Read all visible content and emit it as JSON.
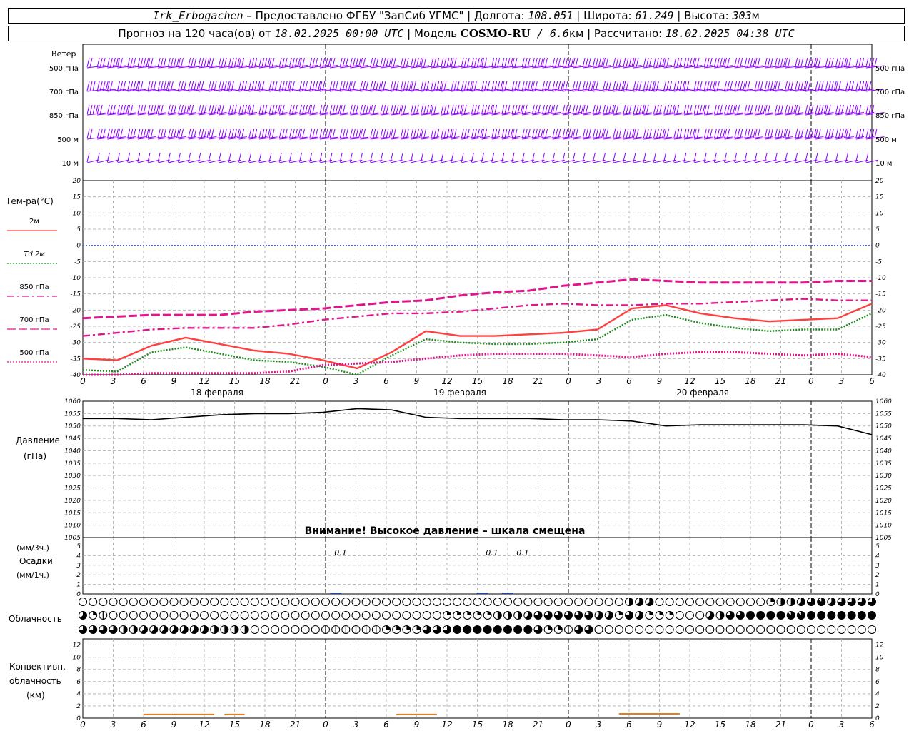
{
  "header": {
    "station": "Irk_Erbogachen",
    "provider": " – Предоставлено ФГБУ \"ЗапСиб УГМС\" | Долгота: ",
    "longitude": "108.051",
    "lat_label": " | Широта: ",
    "latitude": "61.249",
    "alt_label": " | Высота: ",
    "altitude": "303",
    "alt_unit": "м",
    "forecast_prefix": "Прогноз на 120 часа(ов) от ",
    "forecast_start": "18.02.2025 00:00 UTC",
    "model_label": " | Модель ",
    "model": "COSMO-RU",
    "resolution": " / 6.6",
    "res_unit": "км | Рассчитано: ",
    "computed": "18.02.2025 04:38 UTC"
  },
  "wind_panel": {
    "title": "Ветер",
    "levels": [
      "500 гПа",
      "700 гПа",
      "850 гПа",
      "500 м",
      "10 м"
    ],
    "color": "#8b00ff"
  },
  "temp_panel": {
    "title": "Тем-ра(°C)",
    "legend": [
      {
        "label": "2м",
        "color": "#ff4040",
        "style": "solid"
      },
      {
        "label": "Td 2м",
        "color": "#1a8a1a",
        "style": "dotted"
      },
      {
        "label": "850 гПа",
        "color": "#e0168c",
        "style": "dashdot"
      },
      {
        "label": "700 гПа",
        "color": "#e0168c",
        "style": "dash"
      },
      {
        "label": "500 гПа",
        "color": "#e0168c",
        "style": "dot"
      }
    ],
    "date_labels": [
      "18 февраля",
      "19 февраля",
      "20 февраля"
    ]
  },
  "pressure_panel": {
    "title": "Давление",
    "unit": "(гПа)",
    "warning": "Внимание! Высокое давление – шкала смещена"
  },
  "precip_panel": {
    "unit3": "(мм/3ч.)",
    "title": "Осадки",
    "unit1": "(мм/1ч.)",
    "annotations": [
      "0.1",
      "0.1",
      "0.1"
    ]
  },
  "cloud_panel": {
    "title": "Облачность"
  },
  "conv_panel": {
    "title": [
      "Конвективн.",
      "облачность",
      "(км)"
    ],
    "color": "#e08020"
  },
  "chart_data": [
    {
      "type": "line",
      "title": "Тем-ра(°C)",
      "ylim": [
        -40,
        20
      ],
      "y_ticks": [
        20,
        15,
        10,
        5,
        0,
        -5,
        -10,
        -15,
        -20,
        -25,
        -30,
        -35,
        -40
      ],
      "x": [
        0,
        3,
        6,
        9,
        12,
        15,
        18,
        21,
        24,
        27,
        30,
        33,
        36,
        39,
        42,
        45,
        48,
        51,
        54,
        57,
        60,
        63,
        66,
        69,
        72,
        75,
        78
      ],
      "x_tick_labels": [
        "0",
        "3",
        "6",
        "9",
        "12",
        "15",
        "18",
        "21",
        "0",
        "3",
        "6",
        "9",
        "12",
        "15",
        "18",
        "21",
        "0",
        "3",
        "6",
        "9",
        "12",
        "15",
        "18",
        "21",
        "0",
        "3",
        "6"
      ],
      "series": [
        {
          "name": "2м",
          "values": [
            -35,
            -35.5,
            -31,
            -28.5,
            -30.5,
            -32.5,
            -33.5,
            -35.5,
            -38,
            -33,
            -26.5,
            -28,
            -28,
            -27.5,
            -27,
            -26,
            -19.5,
            -18.5,
            -21,
            -22.5,
            -23.5,
            -23,
            -22.5,
            -18
          ]
        },
        {
          "name": "Td 2м",
          "values": [
            -38.5,
            -39,
            -33,
            -31.5,
            -33.5,
            -35.5,
            -36,
            -37.5,
            -40,
            -34,
            -29,
            -30,
            -30.5,
            -30.5,
            -30,
            -29,
            -23,
            -21.5,
            -24,
            -25.5,
            -26.5,
            -26,
            -26,
            -21
          ]
        },
        {
          "name": "850 гПа",
          "values": [
            -28,
            -27,
            -26,
            -25.5,
            -25.5,
            -25.5,
            -24.5,
            -23,
            -22,
            -21,
            -21,
            -20.5,
            -19.5,
            -18.5,
            -18,
            -18.5,
            -18.5,
            -18,
            -18,
            -17.5,
            -17,
            -16.5,
            -17,
            -17
          ]
        },
        {
          "name": "700 гПа",
          "values": [
            -22.5,
            -22,
            -21.5,
            -21.5,
            -21.5,
            -20.5,
            -20,
            -19.5,
            -18.5,
            -17.5,
            -17,
            -15.5,
            -14.5,
            -14,
            -12.5,
            -11.5,
            -10.5,
            -11,
            -11.5,
            -11.5,
            -11.5,
            -11.5,
            -11,
            -11
          ]
        },
        {
          "name": "500 гПа",
          "values": [
            -40,
            -40,
            -39.5,
            -39.5,
            -39.5,
            -39.5,
            -39,
            -37,
            -36.5,
            -36,
            -35,
            -34,
            -33.5,
            -33.5,
            -33.5,
            -34,
            -34.5,
            -33.5,
            -33,
            -33,
            -33.5,
            -34,
            -33.5,
            -34.5
          ]
        }
      ]
    },
    {
      "type": "line",
      "title": "Давление",
      "ylim": [
        1005,
        1060
      ],
      "y_ticks": [
        1060,
        1055,
        1050,
        1045,
        1040,
        1035,
        1030,
        1025,
        1020,
        1015,
        1010,
        1005
      ],
      "series": [
        {
          "name": "Давление",
          "values": [
            1053,
            1053,
            1052.5,
            1053.5,
            1054.5,
            1055,
            1055,
            1055.5,
            1057,
            1056.5,
            1053.5,
            1053,
            1053,
            1053,
            1052.5,
            1052.5,
            1052,
            1050,
            1050.5,
            1050.5,
            1050.5,
            1050.5,
            1050,
            1046.5
          ]
        }
      ]
    },
    {
      "type": "bar",
      "title": "Осадки",
      "ylim": [
        0,
        5
      ],
      "y_ticks": [
        5,
        4,
        3,
        2,
        1,
        0
      ],
      "bars": [
        {
          "x": 25,
          "value": 0.1
        },
        {
          "x": 39.5,
          "value": 0.1
        },
        {
          "x": 42,
          "value": 0.1
        }
      ]
    },
    {
      "type": "area",
      "title": "Конвективн. облачность (км)",
      "ylim": [
        0,
        13
      ],
      "y_ticks": [
        12,
        10,
        8,
        6,
        4,
        2,
        0
      ],
      "segments": [
        {
          "x": [
            6,
            13
          ],
          "value": 0.6
        },
        {
          "x": [
            14,
            16
          ],
          "value": 0.6
        },
        {
          "x": [
            31,
            35
          ],
          "value": 0.6
        },
        {
          "x": [
            53,
            59
          ],
          "value": 0.7
        }
      ]
    },
    {
      "type": "table",
      "title": "Облачность",
      "rows": [
        {
          "level": "upper",
          "runs": [
            [
              0,
              53,
              0
            ],
            [
              54,
              55,
              4
            ],
            [
              55,
              56,
              5
            ],
            [
              56,
              57,
              5
            ],
            [
              57,
              68,
              0
            ],
            [
              68,
              69,
              3
            ],
            [
              69,
              70,
              4
            ],
            [
              70,
              71,
              4
            ],
            [
              71,
              72,
              5
            ],
            [
              72,
              73,
              6
            ],
            [
              73,
              74,
              7
            ],
            [
              74,
              75,
              5
            ],
            [
              75,
              78,
              6
            ]
          ]
        },
        {
          "level": "middle",
          "runs": [
            [
              0,
              1,
              5
            ],
            [
              1,
              2,
              3
            ],
            [
              2,
              3,
              2
            ],
            [
              3,
              36,
              0
            ],
            [
              36,
              41,
              3
            ],
            [
              41,
              44,
              4
            ],
            [
              44,
              45,
              5
            ],
            [
              45,
              51,
              6
            ],
            [
              51,
              53,
              5
            ],
            [
              53,
              54,
              3
            ],
            [
              54,
              55,
              6
            ],
            [
              55,
              56,
              5
            ],
            [
              56,
              58,
              3
            ],
            [
              58,
              59,
              3
            ],
            [
              59,
              62,
              0
            ],
            [
              62,
              63,
              5
            ],
            [
              63,
              64,
              4
            ],
            [
              64,
              66,
              6
            ],
            [
              66,
              70,
              8
            ],
            [
              70,
              72,
              7
            ],
            [
              72,
              78,
              8
            ]
          ]
        },
        {
          "level": "lower",
          "runs": [
            [
              0,
              4,
              6
            ],
            [
              4,
              6,
              4
            ],
            [
              6,
              13,
              5
            ],
            [
              13,
              17,
              4
            ],
            [
              17,
              24,
              0
            ],
            [
              24,
              30,
              2
            ],
            [
              30,
              34,
              3
            ],
            [
              34,
              37,
              6
            ],
            [
              37,
              45,
              8
            ],
            [
              45,
              46,
              6
            ],
            [
              46,
              48,
              3
            ],
            [
              48,
              49,
              2
            ],
            [
              49,
              51,
              6
            ],
            [
              51,
              78,
              0
            ]
          ]
        }
      ]
    }
  ]
}
